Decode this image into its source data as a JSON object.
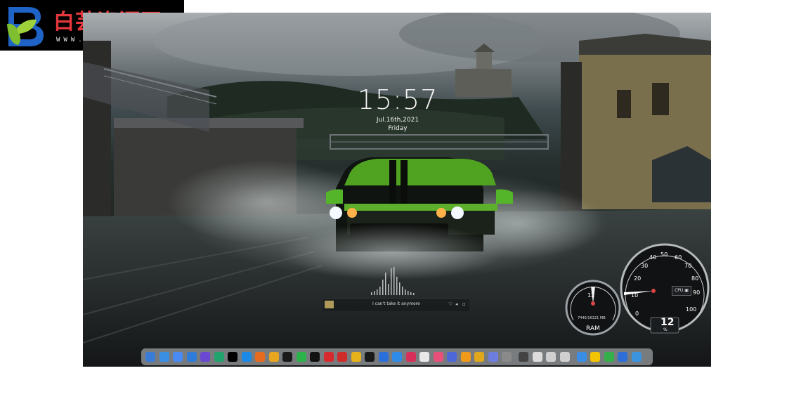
{
  "watermark": {
    "title": "白芸资源网",
    "url": "WWW.52BYW.CN",
    "logo_letter": "B"
  },
  "desktop": {
    "clock": {
      "time": "15:57",
      "date": "Jul.16th,2021",
      "day": "Friday"
    },
    "music": {
      "song": "I can't take it anymore"
    },
    "ram_gauge": {
      "value": "12",
      "label": "RAM",
      "memory": "7446/16321 MB"
    },
    "cpu_gauge": {
      "label": "CPU",
      "value": "12",
      "unit": "%",
      "ticks": [
        "0",
        "10",
        "20",
        "30",
        "40",
        "50",
        "60",
        "70",
        "80",
        "90",
        "100"
      ]
    },
    "dock_icons": [
      "finder-icon",
      "downloads-icon",
      "launchpad-icon",
      "windows-icon",
      "notes-icon",
      "wechat-mini-icon",
      "apple-icon",
      "edge-icon",
      "firefox-icon",
      "chrome-icon",
      "qq-icon",
      "wechat-icon",
      "tiktok-icon",
      "netease-music-icon",
      "stream-icon",
      "ubuntu-icon",
      "pictures-icon",
      "sparrow-icon",
      "tasks-icon",
      "jira-icon",
      "mail-icon",
      "pinwheel-icon",
      "mountains-icon",
      "disk-icon",
      "files-icon",
      "audio-icon",
      "photos-icon",
      "power-icon",
      "more-icon",
      "collapse-icon",
      "collapse-icon",
      "photoshop-icon",
      "fireworks-icon",
      "dreamweaver-icon",
      "gallery-icon",
      "trash-icon"
    ],
    "dock_colors": [
      "#3a7bd5",
      "#3b8fe2",
      "#4a8af4",
      "#2f7bd9",
      "#6a48d1",
      "#20a36c",
      "#000000",
      "#1a8ae6",
      "#e66b1f",
      "#e6a61f",
      "#1a1a1a",
      "#2bb34a",
      "#111111",
      "#d8292f",
      "#cf2b2b",
      "#e5b21a",
      "#1a1a1a",
      "#2b6fdb",
      "#2f8be8",
      "#d72f5a",
      "#e8e8e8",
      "#e84f7a",
      "#4d67d9",
      "#f19a1a",
      "#e0a81a",
      "#6d7ee0",
      "#8a8a8a",
      "#444444",
      "#dcdcdc",
      "#cfcfcf",
      "#cfcfcf",
      "#3b8ee6",
      "#f5c400",
      "#34b04a",
      "#2d6fd6",
      "#3b94e0"
    ]
  }
}
